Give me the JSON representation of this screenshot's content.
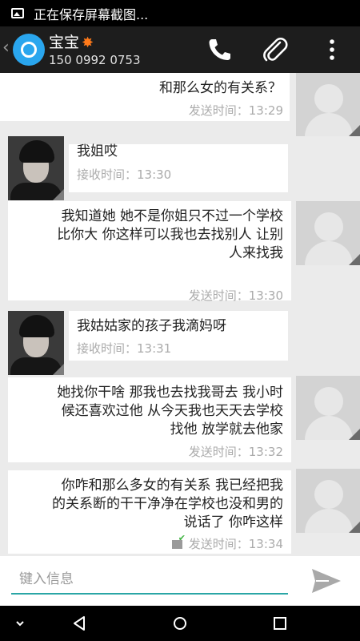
{
  "status_bar": {
    "notification_text": "正在保存屏幕截图..."
  },
  "contact": {
    "name": "宝宝",
    "number": "150 0992 0753"
  },
  "action_bar": {
    "back_icon": "chevron-left-icon",
    "app_icon": "messaging-app-logo",
    "call_icon": "phone-icon",
    "attach_icon": "paperclip-icon",
    "menu_icon": "overflow-menu-icon"
  },
  "messages": [
    {
      "direction": "sent",
      "text": "和那么女的有关系？",
      "time": "发送时间：13:29"
    },
    {
      "direction": "received",
      "text": "我姐哎",
      "time": "接收时间：13:30"
    },
    {
      "direction": "sent",
      "text": "我知道她 她不是你姐只不过一个学校\n比你大 你这样可以我也去找别人 让别\n人来找我",
      "time": "发送时间：13:30"
    },
    {
      "direction": "received",
      "text": "我姑姑家的孩子我滴妈呀",
      "time": "接收时间：13:31"
    },
    {
      "direction": "sent",
      "text": "她找你干啥 那我也去找我哥去 我小时\n候还喜欢过他 从今天我也天天去学校\n找他 放学就去他家",
      "time": "发送时间：13:32"
    },
    {
      "direction": "sent",
      "text": "你咋和那么多女的有关系 我已经把我\n的关系断的干干净净在学校也没和男的\n说话了 你咋这样",
      "time": "发送时间：13:34",
      "delivered_icon": "delivered-check-icon"
    }
  ],
  "compose": {
    "placeholder": "键入信息",
    "send_icon": "send-icon"
  },
  "nav_bar": {
    "down_icon": "nav-down-icon",
    "back_icon": "nav-back-icon",
    "home_icon": "nav-home-icon",
    "recents_icon": "nav-recents-icon"
  },
  "colors": {
    "accent": "#2aa6ee",
    "action_bar": "#1d1d1d",
    "background": "#ebebeb",
    "input_underline": "#2aa6a6"
  }
}
